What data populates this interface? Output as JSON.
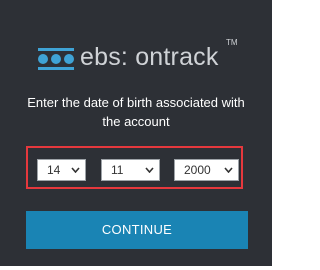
{
  "brand": {
    "name": "ebs: ontrack",
    "trademark": "TM",
    "icon": "ebs-dots-logo-icon",
    "accent_color": "#3fa3d6"
  },
  "prompt": {
    "text": "Enter the date of birth associated with the account"
  },
  "dob": {
    "day": "14",
    "month": "11",
    "year": "2000",
    "highlight_color": "#e5383d"
  },
  "actions": {
    "continue_label": "CONTINUE",
    "continue_color": "#1a84b4"
  }
}
